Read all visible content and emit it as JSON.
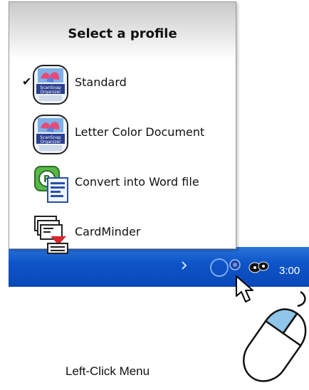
{
  "menu": {
    "title": "Select a profile",
    "items": [
      {
        "label": "Standard",
        "checked": true,
        "icon": "scan-to-organizer-icon"
      },
      {
        "label": "Letter Color Document",
        "checked": false,
        "icon": "scan-to-organizer-icon"
      },
      {
        "label": "Convert into Word file",
        "checked": false,
        "icon": "word-convert-icon"
      },
      {
        "label": "CardMinder",
        "checked": false,
        "icon": "cardminder-icon"
      }
    ],
    "check_glyph": "✔"
  },
  "taskbar": {
    "clock": "3:00",
    "color": "#0e55c8"
  },
  "caption": "Left-Click Menu",
  "mouse_icon": "mouse-left-click-icon",
  "cursor_icon": "arrow-cursor-icon"
}
